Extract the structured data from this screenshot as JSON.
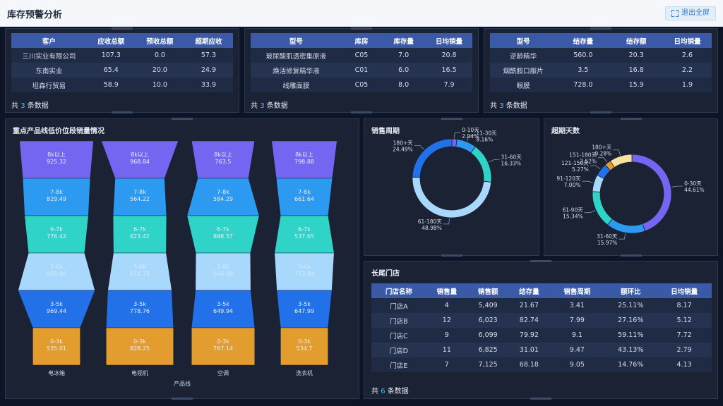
{
  "header": {
    "title": "库存预警分析",
    "exit_label": "退出全屏"
  },
  "table1": {
    "columns": [
      "客户",
      "应收总额",
      "预收总额",
      "超期应收"
    ],
    "rows": [
      [
        "三川实业有限公司",
        "107.3",
        "0.0",
        "57.3"
      ],
      [
        "东南实业",
        "65.4",
        "20.0",
        "24.9"
      ],
      [
        "坦森行贸易",
        "58.9",
        "10.0",
        "33.9"
      ]
    ],
    "footer": {
      "prefix": "共",
      "count": "3",
      "suffix": "条数据"
    }
  },
  "table2": {
    "columns": [
      "型号",
      "库房",
      "库存量",
      "日均销量"
    ],
    "rows": [
      [
        "玻尿酸肌透密集原液",
        "C05",
        "7.0",
        "20.8"
      ],
      [
        "焕活修复精华液",
        "C01",
        "6.0",
        "16.5"
      ],
      [
        "线雕面膜",
        "C05",
        "8.0",
        "7.9"
      ]
    ],
    "footer": {
      "prefix": "共",
      "count": "3",
      "suffix": "条数据"
    }
  },
  "table3": {
    "columns": [
      "型号",
      "结存量",
      "结存额",
      "日均销量"
    ],
    "rows": [
      [
        "逆龄精华",
        "560.0",
        "20.3",
        "2.6"
      ],
      [
        "烟酰胺口服片",
        "3.5",
        "16.8",
        "2.2"
      ],
      [
        "眼膜",
        "728.0",
        "15.9",
        "1.9"
      ]
    ],
    "footer": {
      "prefix": "共",
      "count": "3",
      "suffix": "条数据"
    }
  },
  "funnel_panel": {
    "title": "重点产品线低价位段销量情况"
  },
  "cycle_panel": {
    "title": "销售周期"
  },
  "overdue_panel": {
    "title": "超期天数"
  },
  "store_panel": {
    "title": "长尾门店",
    "columns": [
      "门店名称",
      "销售量",
      "销售额",
      "结存量",
      "销售周期",
      "额环比",
      "日均销量"
    ],
    "rows": [
      [
        "门店A",
        "4",
        "5,409",
        "21.67",
        "3.41",
        "25.11%",
        "8.17"
      ],
      [
        "门店B",
        "12",
        "6,023",
        "82.74",
        "7.99",
        "27.16%",
        "5.12"
      ],
      [
        "门店C",
        "9",
        "6,099",
        "79.92",
        "9.1",
        "59.11%",
        "7.72"
      ],
      [
        "门店D",
        "11",
        "6,825",
        "31.01",
        "9.47",
        "43.13%",
        "2.79"
      ],
      [
        "门店E",
        "7",
        "7,125",
        "68.18",
        "9.05",
        "14.76%",
        "4.13"
      ]
    ],
    "footer": {
      "prefix": "共",
      "count": "6",
      "suffix": "条数据"
    }
  },
  "colors": {
    "band_8k": "#7466f0",
    "band_7_8k": "#2b9af0",
    "band_6_7k": "#2fd3c8",
    "band_5_6k": "#a8d8fb",
    "band_3_5k": "#2371e8",
    "band_0_3k": "#e39d2f"
  },
  "chart_data": [
    {
      "type": "funnel",
      "xlabel": "产品线",
      "categories": [
        "电冰箱",
        "电视机",
        "空调",
        "洗衣机"
      ],
      "bands": [
        "8k以上",
        "7-8k",
        "6-7k",
        "5-6k",
        "3-5k",
        "0-3k"
      ],
      "series": [
        {
          "name": "电冰箱",
          "values": [
            925.32,
            829.49,
            776.42,
            662.96,
            969.44,
            535.01
          ]
        },
        {
          "name": "电视机",
          "values": [
            968.84,
            564.22,
            623.42,
            612.78,
            778.76,
            828.25
          ]
        },
        {
          "name": "空调",
          "values": [
            763.5,
            584.29,
            898.57,
            640.68,
            649.94,
            767.14
          ]
        },
        {
          "name": "洗衣机",
          "values": [
            798.88,
            661.64,
            537.65,
            713.84,
            647.99,
            534.7
          ]
        }
      ]
    },
    {
      "type": "pie",
      "categories": [
        "0-10天",
        "11-30天",
        "31-60天",
        "61-180天",
        "180+天"
      ],
      "values": [
        2.04,
        8.16,
        16.33,
        48.98,
        24.49
      ],
      "labels": [
        "2.04%",
        "8.16%",
        "16.33%",
        "48.98%",
        "24.49%"
      ],
      "colors": [
        "#7466f0",
        "#2b9af0",
        "#2fd3c8",
        "#a8d8fb",
        "#2371e8"
      ]
    },
    {
      "type": "pie",
      "categories": [
        "0-30天",
        "31-60天",
        "61-90天",
        "91-120天",
        "121-150天",
        "151-180天",
        "180+天"
      ],
      "values": [
        44.61,
        15.97,
        15.34,
        7.0,
        5.27,
        2.52,
        9.28
      ],
      "labels": [
        "44.61%",
        "15.97%",
        "15.34%",
        "7.00%",
        "5.27%",
        "2.52%",
        "9.28%"
      ],
      "colors": [
        "#7466f0",
        "#2b9af0",
        "#2fd3c8",
        "#a8d8fb",
        "#2371e8",
        "#e39d2f",
        "#f7e2a1"
      ]
    }
  ]
}
